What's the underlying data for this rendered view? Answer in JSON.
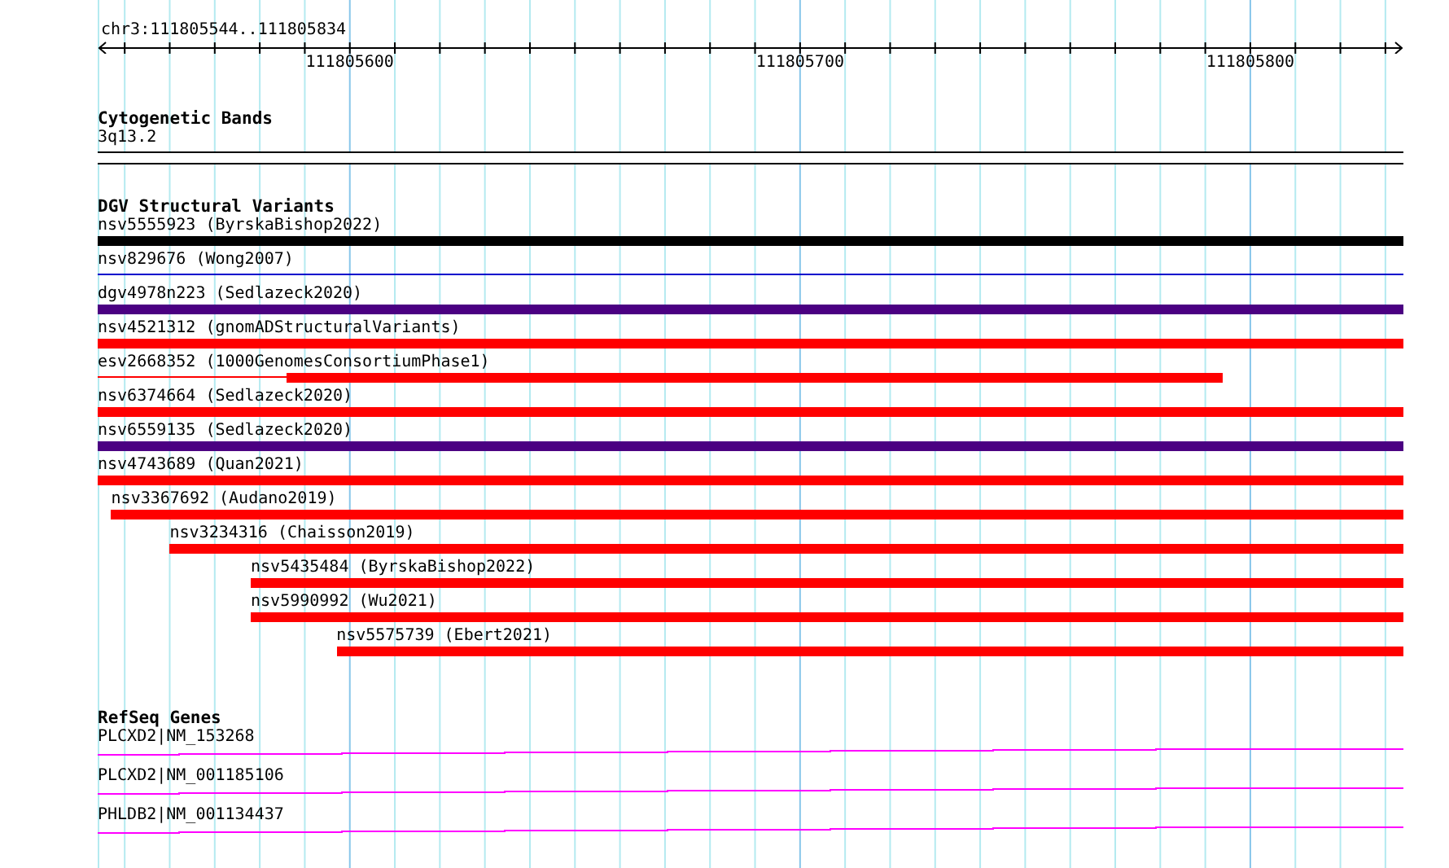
{
  "ruler": {
    "location": "chr3:111805544..111805834",
    "tick_labels": [
      "111805600",
      "111805700",
      "111805800"
    ]
  },
  "cytoband": {
    "title": "Cytogenetic Bands",
    "band": "3q13.2"
  },
  "variants": {
    "title": "DGV Structural Variants",
    "features": [
      {
        "label": "nsv5555923 (ByrskaBishop2022)",
        "color": "#000000",
        "kind": "bar"
      },
      {
        "label": "nsv829676 (Wong2007)",
        "color": "#0000cc",
        "kind": "line"
      },
      {
        "label": "dgv4978n223 (Sedlazeck2020)",
        "color": "#4b0082",
        "kind": "bar"
      },
      {
        "label": "nsv4521312 (gnomADStructuralVariants)",
        "color": "#ff0000",
        "kind": "bar"
      },
      {
        "label": "esv2668352 (1000GenomesConsortiumPhase1)",
        "color": "#ff0000",
        "kind": "mixed"
      },
      {
        "label": "nsv6374664 (Sedlazeck2020)",
        "color": "#ff0000",
        "kind": "bar"
      },
      {
        "label": "nsv6559135 (Sedlazeck2020)",
        "color": "#4b0082",
        "kind": "bar"
      },
      {
        "label": "nsv4743689 (Quan2021)",
        "color": "#ff0000",
        "kind": "bar"
      },
      {
        "label": "nsv3367692 (Audano2019)",
        "color": "#ff0000",
        "kind": "bar"
      },
      {
        "label": "nsv3234316 (Chaisson2019)",
        "color": "#ff0000",
        "kind": "bar"
      },
      {
        "label": "nsv5435484 (ByrskaBishop2022)",
        "color": "#ff0000",
        "kind": "bar"
      },
      {
        "label": "nsv5990992 (Wu2021)",
        "color": "#ff0000",
        "kind": "bar"
      },
      {
        "label": "nsv5575739 (Ebert2021)",
        "color": "#ff0000",
        "kind": "bar"
      }
    ]
  },
  "genes": {
    "title": "RefSeq Genes",
    "transcripts": [
      {
        "label": "PLCXD2|NM_153268"
      },
      {
        "label": "PLCXD2|NM_001185106"
      },
      {
        "label": "PHLDB2|NM_001134437"
      }
    ]
  }
}
